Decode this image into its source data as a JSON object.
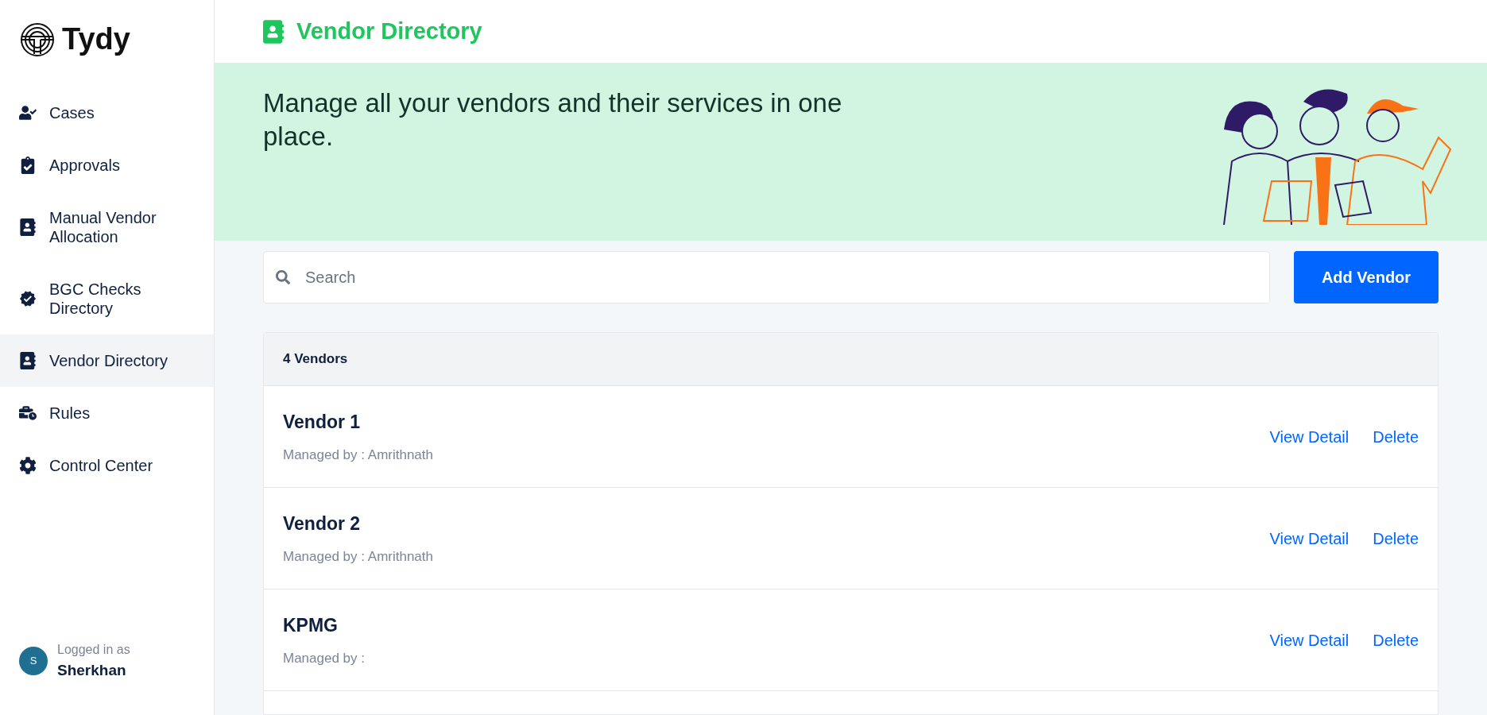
{
  "brand": {
    "name": "Tydy"
  },
  "sidebar": {
    "items": [
      {
        "label": "Cases",
        "selected": false
      },
      {
        "label": "Approvals",
        "selected": false
      },
      {
        "label": "Manual Vendor Allocation",
        "selected": false
      },
      {
        "label": "BGC Checks Directory",
        "selected": false
      },
      {
        "label": "Vendor Directory",
        "selected": true
      },
      {
        "label": "Rules",
        "selected": false
      },
      {
        "label": "Control Center",
        "selected": false
      }
    ],
    "user": {
      "avatar_initial": "S",
      "caption": "Logged in as",
      "name": "Sherkhan"
    }
  },
  "header": {
    "title": "Vendor Directory"
  },
  "banner": {
    "text": "Manage all your vendors and their services in one place."
  },
  "search": {
    "placeholder": "Search"
  },
  "add_button": "Add Vendor",
  "list": {
    "count": "4 Vendors",
    "rows": [
      {
        "name": "Vendor 1",
        "manager": "Managed by : Amrithnath",
        "actions": [
          "View Detail",
          "Delete"
        ]
      },
      {
        "name": "Vendor 2",
        "manager": "Managed by : Amrithnath",
        "actions": [
          "View Detail",
          "Delete"
        ]
      },
      {
        "name": "KPMG",
        "manager": "Managed by :",
        "actions": [
          "View Detail",
          "Delete"
        ]
      }
    ]
  }
}
